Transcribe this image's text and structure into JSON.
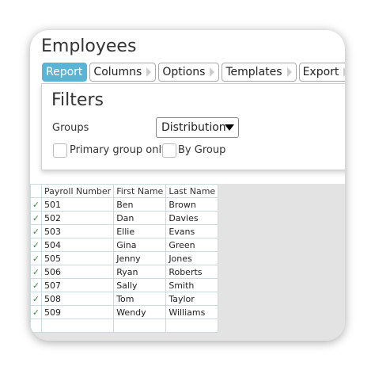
{
  "page": {
    "title": "Employees"
  },
  "tabs": [
    {
      "label": "Report",
      "active": true
    },
    {
      "label": "Columns"
    },
    {
      "label": "Options"
    },
    {
      "label": "Templates"
    },
    {
      "label": "Export"
    }
  ],
  "filters": {
    "title": "Filters",
    "groups_label": "Groups",
    "groups_value": "Distribution",
    "primary_group_only": "Primary group only",
    "by_group": "By Group"
  },
  "table": {
    "headers": [
      "Payroll Number",
      "First Name",
      "Last Name"
    ],
    "check_mark": "✓",
    "rows": [
      [
        "501",
        "Ben",
        "Brown"
      ],
      [
        "502",
        "Dan",
        "Davies"
      ],
      [
        "503",
        "Ellie",
        "Evans"
      ],
      [
        "504",
        "Gina",
        "Green"
      ],
      [
        "505",
        "Jenny",
        "Jones"
      ],
      [
        "506",
        "Ryan",
        "Roberts"
      ],
      [
        "507",
        "Sally",
        "Smith"
      ],
      [
        "508",
        "Tom",
        "Taylor"
      ],
      [
        "509",
        "Wendy",
        "Williams"
      ]
    ]
  },
  "colors": {
    "accent": "#5ab4d6",
    "check": "#3a8a3a",
    "grid_line": "#c8dce0"
  }
}
